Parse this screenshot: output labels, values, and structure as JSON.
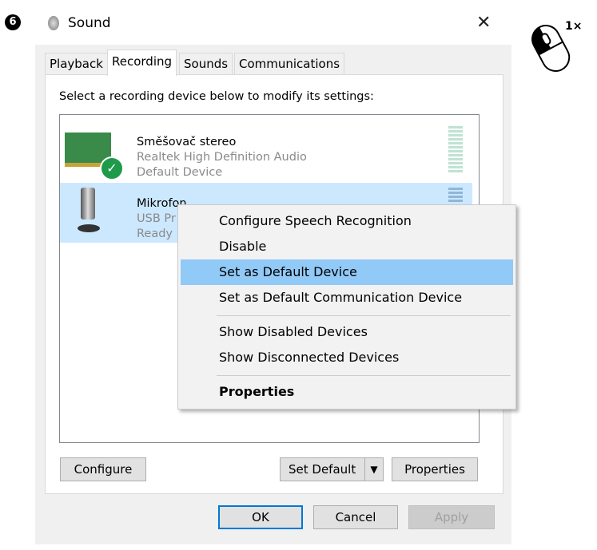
{
  "step": "6",
  "badge": "1×",
  "window": {
    "title": "Sound",
    "close": "✕"
  },
  "tabs": [
    {
      "label": "Playback"
    },
    {
      "label": "Recording"
    },
    {
      "label": "Sounds"
    },
    {
      "label": "Communications"
    }
  ],
  "instruction": "Select a recording device below to modify its settings:",
  "devices": [
    {
      "name": "Směšovač stereo",
      "driver": "Realtek High Definition Audio",
      "status": "Default Device"
    },
    {
      "name": "Mikrofon",
      "driver": "USB Pr",
      "status": "Ready"
    }
  ],
  "context_menu": {
    "items": [
      "Configure Speech Recognition",
      "Disable",
      "Set as Default Device",
      "Set as Default Communication Device",
      "Show Disabled Devices",
      "Show Disconnected Devices",
      "Properties"
    ]
  },
  "buttons": {
    "configure": "Configure",
    "set_default": "Set Default",
    "properties": "Properties",
    "ok": "OK",
    "cancel": "Cancel",
    "apply": "Apply"
  }
}
